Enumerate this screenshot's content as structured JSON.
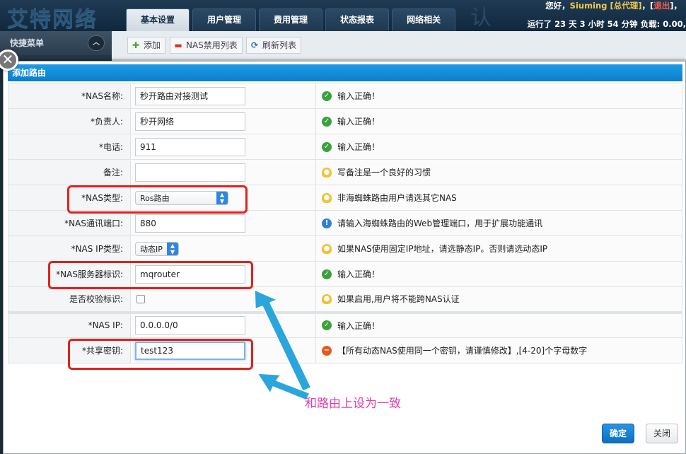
{
  "header": {
    "logo": "艾特网络",
    "watermark": "认",
    "tabs": [
      {
        "label": "基本设置",
        "active": true
      },
      {
        "label": "用户管理",
        "active": false
      },
      {
        "label": "费用管理",
        "active": false
      },
      {
        "label": "状态报表",
        "active": false
      },
      {
        "label": "网络相关",
        "active": false
      }
    ],
    "greeting_prefix": "您好，",
    "username": "Siuming",
    "role": "[总代理]",
    "logout_open": "，[",
    "logout": "退出",
    "logout_close": "]，",
    "uptime": "运行了 23 天 3 小时 54 分钟 负载: 0.00,"
  },
  "sidebar": {
    "title": "快捷菜单",
    "collapse_icon": "chevron-up-icon"
  },
  "toolbar": {
    "add": "添加",
    "nas_ban": "NAS禁用列表",
    "refresh": "刷新列表"
  },
  "modal": {
    "title": "添加路由",
    "rows": [
      {
        "label": "*NAS名称:",
        "value": "秒开路由对接测试",
        "hint_icon": "check-icon",
        "hint": "输入正确！"
      },
      {
        "label": "*负责人:",
        "value": "秒开网络",
        "hint_icon": "check-icon",
        "hint": "输入正确！"
      },
      {
        "label": "*电话:",
        "value": "911",
        "hint_icon": "check-icon",
        "hint": "输入正确！"
      },
      {
        "label": "备注:",
        "value": "",
        "hint_icon": "lightbulb-icon",
        "hint": "写备注是一个良好的习惯"
      },
      {
        "label": "*NAS类型:",
        "select": "Ros路由",
        "hint_icon": "lightbulb-icon",
        "hint": "非海蜘蛛路由用户请选其它NAS"
      },
      {
        "label": "*NAS通讯端口:",
        "value": "880",
        "hint_icon": "info-icon",
        "hint": "请输入海蜘蛛路由的Web管理端口，用于扩展功能通讯"
      },
      {
        "label": "*NAS IP类型:",
        "select": "动态IP",
        "hint_icon": "lightbulb-icon",
        "hint": "如果NAS使用固定IP地址，请选静态IP。否则请选动态IP"
      },
      {
        "label": "*NAS服务器标识:",
        "value": "mqrouter",
        "hint_icon": "check-icon",
        "hint": "输入正确！"
      },
      {
        "label": "是否校验标识:",
        "checkbox": false,
        "hint_icon": "lightbulb-icon",
        "hint": "如果启用,用户将不能跨NAS认证"
      },
      {
        "label": "*NAS IP:",
        "value": "0.0.0.0/0",
        "hint_icon": "check-icon",
        "hint": "输入正确！"
      },
      {
        "label": "*共享密钥:",
        "value": "test123",
        "hint_icon": "minus-circle-icon",
        "hint": "【所有动态NAS使用同一个密钥，请谨慎修改】,[4-20]个字母数字"
      }
    ],
    "annotation": "和路由上设为一致",
    "ok": "确定",
    "close": "关闭"
  },
  "colors": {
    "title_bar": "#0a7fcc",
    "highlight_box": "#e3201b",
    "arrow": "#2aa6dc",
    "annotation": "#e13fa8"
  }
}
